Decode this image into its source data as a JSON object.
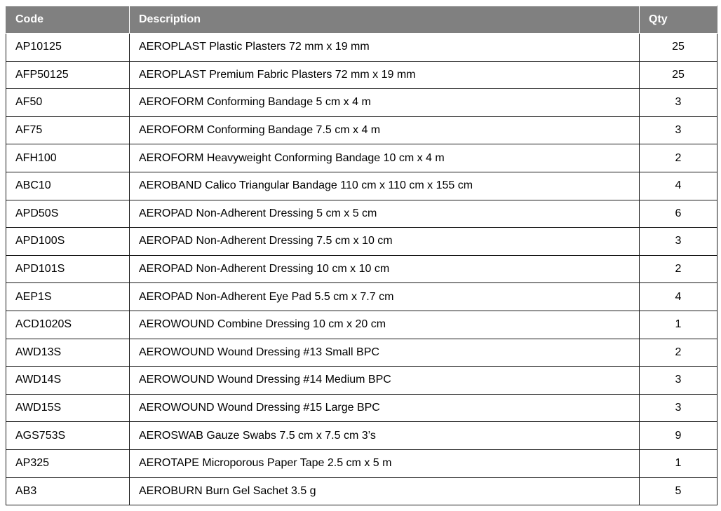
{
  "table": {
    "headers": {
      "code": "Code",
      "description": "Description",
      "qty": "Qty"
    },
    "rows": [
      {
        "code": "AP10125",
        "description": "AEROPLAST Plastic Plasters 72 mm x 19 mm",
        "qty": "25"
      },
      {
        "code": "AFP50125",
        "description": "AEROPLAST Premium Fabric Plasters 72 mm x 19 mm",
        "qty": "25"
      },
      {
        "code": "AF50",
        "description": "AEROFORM Conforming Bandage 5 cm x 4 m",
        "qty": "3"
      },
      {
        "code": "AF75",
        "description": "AEROFORM Conforming Bandage 7.5 cm x 4 m",
        "qty": "3"
      },
      {
        "code": "AFH100",
        "description": "AEROFORM Heavyweight Conforming Bandage 10 cm x 4 m",
        "qty": "2"
      },
      {
        "code": "ABC10",
        "description": "AEROBAND Calico Triangular Bandage 110 cm x 110 cm x 155 cm",
        "qty": "4"
      },
      {
        "code": "APD50S",
        "description": "AEROPAD Non-Adherent Dressing 5 cm x 5 cm",
        "qty": "6"
      },
      {
        "code": "APD100S",
        "description": "AEROPAD Non-Adherent Dressing 7.5 cm x 10 cm",
        "qty": "3"
      },
      {
        "code": "APD101S",
        "description": "AEROPAD Non-Adherent Dressing 10 cm x 10 cm",
        "qty": "2"
      },
      {
        "code": "AEP1S",
        "description": "AEROPAD Non-Adherent Eye Pad 5.5 cm x 7.7 cm",
        "qty": "4"
      },
      {
        "code": "ACD1020S",
        "description": "AEROWOUND Combine Dressing 10 cm x 20 cm",
        "qty": "1"
      },
      {
        "code": "AWD13S",
        "description": "AEROWOUND Wound Dressing #13 Small BPC",
        "qty": "2"
      },
      {
        "code": "AWD14S",
        "description": "AEROWOUND Wound Dressing #14 Medium BPC",
        "qty": "3"
      },
      {
        "code": "AWD15S",
        "description": "AEROWOUND Wound Dressing #15 Large BPC",
        "qty": "3"
      },
      {
        "code": "AGS753S",
        "description": "AEROSWAB Gauze Swabs 7.5 cm x 7.5 cm 3’s",
        "qty": "9"
      },
      {
        "code": "AP325",
        "description": "AEROTAPE Microporous Paper Tape 2.5 cm x 5 m",
        "qty": "1"
      },
      {
        "code": "AB3",
        "description": "AEROBURN Burn Gel Sachet 3.5 g",
        "qty": "5"
      }
    ]
  },
  "colors": {
    "header_bg": "#808080",
    "header_text": "#ffffff",
    "border": "#1a1a1a"
  }
}
